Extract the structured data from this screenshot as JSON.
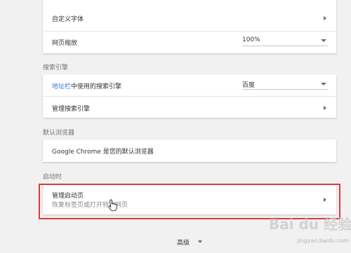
{
  "appearance": {
    "custom_fonts_label": "自定义字体",
    "zoom_label": "网页缩放",
    "zoom_value": "100%"
  },
  "search_engine": {
    "section_title": "搜索引擎",
    "address_bar_link": "地址栏",
    "address_bar_rest": "中使用的搜索引擎",
    "engine_value": "百度",
    "manage_label": "管理搜索引擎"
  },
  "default_browser": {
    "section_title": "默认浏览器",
    "status_text": "Google Chrome 是您的默认浏览器"
  },
  "on_startup": {
    "section_title": "启动时",
    "manage_pages_label": "管理启动页",
    "manage_pages_desc": "恢复标签页或打开特定网页"
  },
  "advanced": {
    "label": "高级"
  },
  "watermark": {
    "text": "Bai du 经验",
    "sub": "jingyan.baidu.com"
  },
  "colors": {
    "link": "#3a78d6",
    "highlight_border": "#e0393e",
    "background": "#f1f1f1"
  }
}
